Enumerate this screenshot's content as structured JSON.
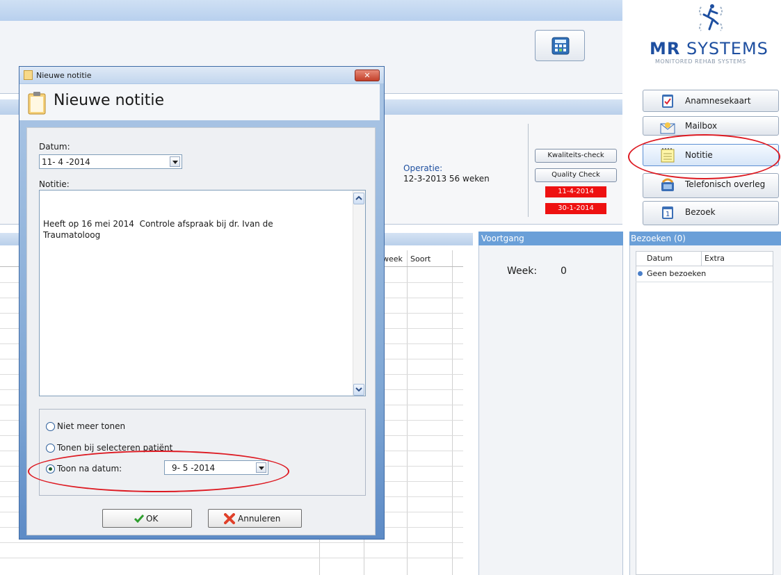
{
  "brand": {
    "logo_main_1": "MR",
    "logo_main_2": "SYSTEMS",
    "logo_sub": "MONITORED REHAB SYSTEMS",
    "colors": {
      "primary": "#1e4fa0",
      "accent": "#4a7fc8"
    }
  },
  "patient": {
    "operatie_label": "Operatie:",
    "operatie_value": "12-3-2013  56 weken",
    "kwaliteits_check": "Kwaliteits-check",
    "quality_check": "Quality Check",
    "badge_1": "11-4-2014",
    "badge_2": "30-1-2014",
    "badge_color": "#ee1111"
  },
  "grid": {
    "col_week": "week",
    "col_soort": "Soort"
  },
  "voortgang": {
    "header": "Voortgang",
    "week_label": "Week:",
    "week_value": "0"
  },
  "sidebar": {
    "buttons": [
      {
        "label": "Anamnesekaart",
        "icon": "clipboard-check-icon"
      },
      {
        "label": "Mailbox",
        "icon": "envelope-icon"
      },
      {
        "label": "Notitie",
        "icon": "notepad-icon"
      },
      {
        "label": "Telefonisch overleg",
        "icon": "telephone-icon"
      },
      {
        "label": "Bezoek",
        "icon": "calendar-icon"
      }
    ]
  },
  "bezoeken": {
    "header": "Bezoeken (0)",
    "col_datum": "Datum",
    "col_extra": "Extra",
    "empty_row": "Geen bezoeken"
  },
  "dialog": {
    "window_title": "Nieuwe notitie",
    "close_glyph": "✕",
    "heading": "Nieuwe notitie",
    "datum_label": "Datum:",
    "datum_value": "11- 4 -2014",
    "notitie_label": "Notitie:",
    "notitie_text": "Heeft op 16 mei 2014  Controle afspraak bij dr. Ivan de\nTraumatoloog",
    "radio_options": [
      {
        "label": "Niet meer tonen",
        "selected": false
      },
      {
        "label": "Tonen bij selecteren patiënt",
        "selected": false
      },
      {
        "label": "Toon na datum:",
        "selected": true
      }
    ],
    "toon_na_datum_value": "9- 5 -2014",
    "ok_label": "OK",
    "cancel_label": "Annuleren"
  },
  "annotations": {
    "color": "#dd1a22"
  }
}
